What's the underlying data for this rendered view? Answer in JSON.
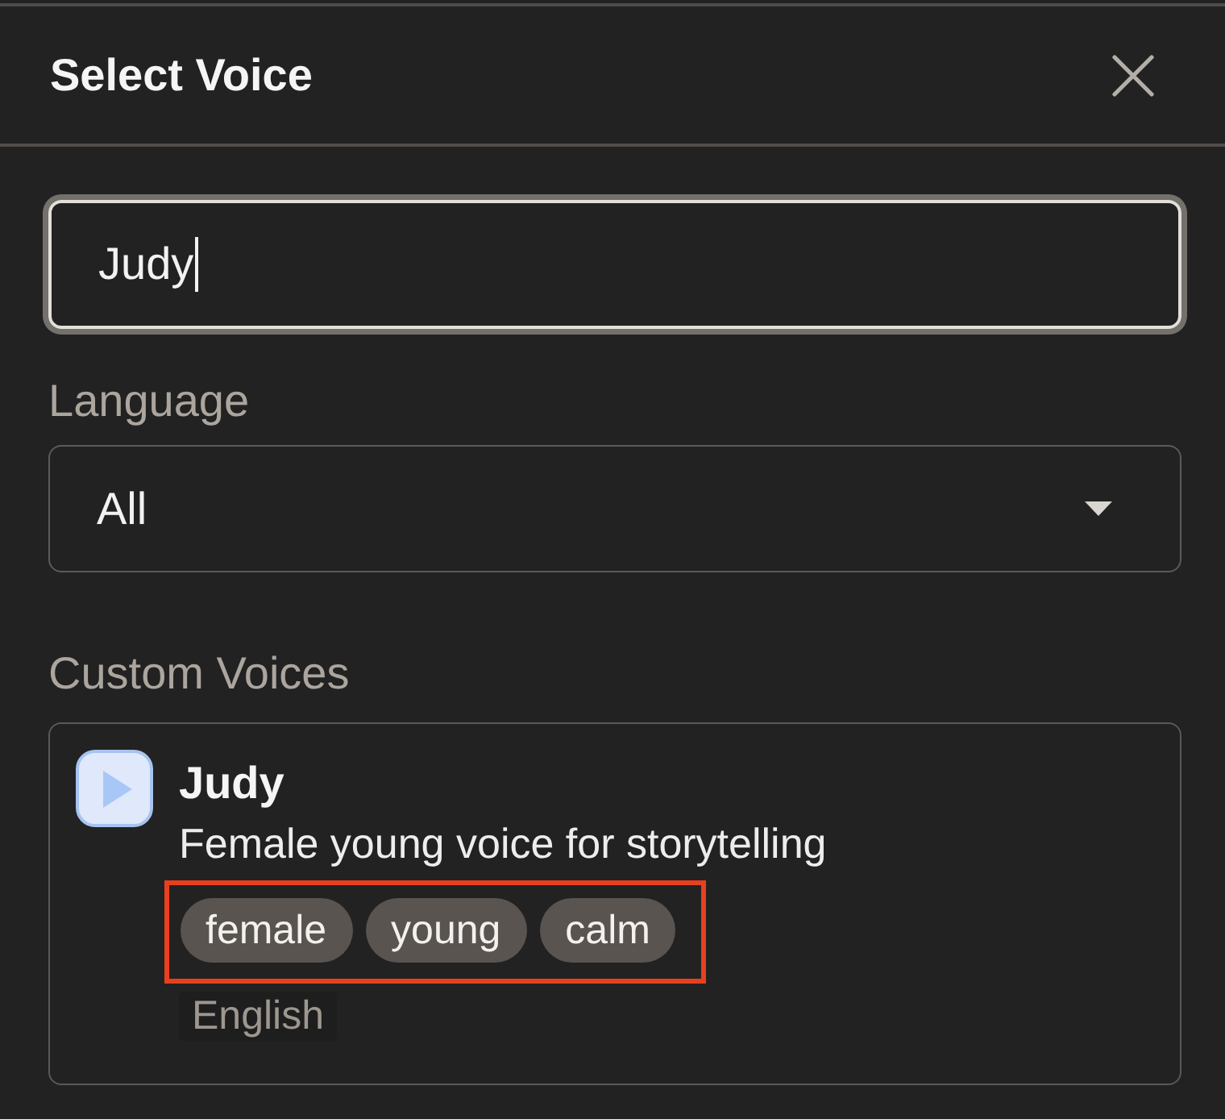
{
  "dialog": {
    "title": "Select Voice"
  },
  "search": {
    "value": "Judy",
    "focused": true
  },
  "language": {
    "label": "Language",
    "value": "All"
  },
  "sections": [
    {
      "heading": "Custom Voices",
      "voices": [
        {
          "name": "Judy",
          "description": "Female young voice for storytelling",
          "tags": [
            "female",
            "young",
            "calm"
          ],
          "tags_highlighted": true,
          "language": "English"
        }
      ]
    }
  ]
}
